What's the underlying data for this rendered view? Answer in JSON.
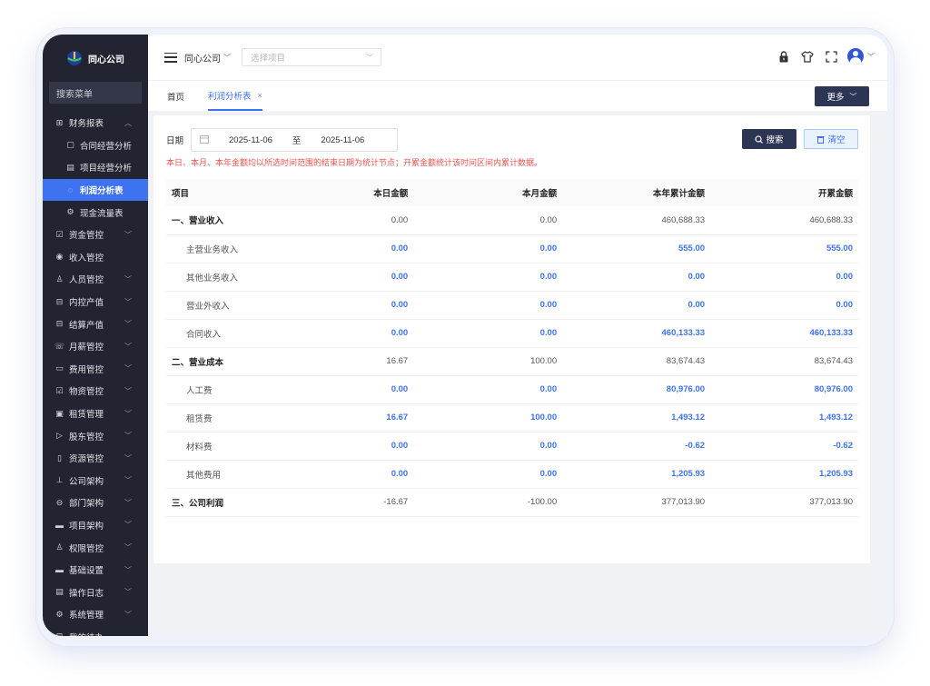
{
  "sidebar": {
    "logo_text": "同心公司",
    "search_label": "搜索菜单",
    "items": [
      {
        "label": "财务报表",
        "icon": "grid-icon",
        "chev": "^"
      },
      {
        "label": "合同经营分析",
        "icon": "document-icon",
        "chev": ""
      },
      {
        "label": "项目经营分析",
        "icon": "file-icon",
        "chev": ""
      },
      {
        "label": "利润分析表",
        "icon": "location-icon",
        "chev": ""
      },
      {
        "label": "现金流量表",
        "icon": "gear-icon",
        "chev": ""
      },
      {
        "label": "资金管控",
        "icon": "checkbox-icon",
        "chev": "v"
      },
      {
        "label": "收入管控",
        "icon": "circle-icon",
        "chev": ""
      },
      {
        "label": "人员管控",
        "icon": "user-icon",
        "chev": "v"
      },
      {
        "label": "内控产值",
        "icon": "table-icon",
        "chev": "v"
      },
      {
        "label": "结算产值",
        "icon": "table-icon",
        "chev": "v"
      },
      {
        "label": "月薪管控",
        "icon": "phone-icon",
        "chev": "v"
      },
      {
        "label": "费用管控",
        "icon": "wallet-icon",
        "chev": "v"
      },
      {
        "label": "物资管控",
        "icon": "checkbox-icon",
        "chev": "v"
      },
      {
        "label": "租赁管理",
        "icon": "lease-icon",
        "chev": "v"
      },
      {
        "label": "股东管控",
        "icon": "send-icon",
        "chev": "v"
      },
      {
        "label": "资源管控",
        "icon": "book-icon",
        "chev": "v"
      },
      {
        "label": "公司架构",
        "icon": "org-icon",
        "chev": "v"
      },
      {
        "label": "部门架构",
        "icon": "minus-circle-icon",
        "chev": "v"
      },
      {
        "label": "项目架构",
        "icon": "bar-icon",
        "chev": "v"
      },
      {
        "label": "权限管控",
        "icon": "user-icon",
        "chev": "v"
      },
      {
        "label": "基础设置",
        "icon": "bar-icon",
        "chev": "v"
      },
      {
        "label": "操作日志",
        "icon": "file-icon",
        "chev": "v"
      },
      {
        "label": "系统管理",
        "icon": "gear-icon",
        "chev": "v"
      },
      {
        "label": "我的待办",
        "icon": "table-icon",
        "chev": ""
      }
    ]
  },
  "topbar": {
    "company": "同心公司",
    "project_placeholder": "选择项目"
  },
  "tabs": {
    "home": "首页",
    "active": "利润分析表",
    "close": "×",
    "more_label": "更多"
  },
  "filter": {
    "date_label": "日期",
    "start": "2025-11-06",
    "separator": "至",
    "end": "2025-11-06",
    "search_label": "搜索",
    "clear_label": "清空",
    "notice": "本日、本月、本年金额均以所选时间范围的结束日期为统计节点；开累金额统计该时间区间内累计数据。"
  },
  "table": {
    "headers": [
      "项目",
      "本日金额",
      "本月金额",
      "本年累计金额",
      "开累金额"
    ],
    "rows": [
      {
        "type": "group",
        "cells": [
          "一、营业收入",
          "0.00",
          "0.00",
          "460,688.33",
          "460,688.33"
        ]
      },
      {
        "type": "child",
        "cells": [
          "主营业务收入",
          "0.00",
          "0.00",
          "555.00",
          "555.00"
        ]
      },
      {
        "type": "child",
        "cells": [
          "其他业务收入",
          "0.00",
          "0.00",
          "0.00",
          "0.00"
        ]
      },
      {
        "type": "child",
        "cells": [
          "营业外收入",
          "0.00",
          "0.00",
          "0.00",
          "0.00"
        ]
      },
      {
        "type": "child",
        "cells": [
          "合同收入",
          "0.00",
          "0.00",
          "460,133.33",
          "460,133.33"
        ]
      },
      {
        "type": "group",
        "cells": [
          "二、营业成本",
          "16.67",
          "100.00",
          "83,674.43",
          "83,674.43"
        ]
      },
      {
        "type": "child",
        "cells": [
          "人工费",
          "0.00",
          "0.00",
          "80,976.00",
          "80,976.00"
        ]
      },
      {
        "type": "child",
        "cells": [
          "租赁费",
          "16.67",
          "100.00",
          "1,493.12",
          "1,493.12"
        ]
      },
      {
        "type": "child",
        "cells": [
          "材料费",
          "0.00",
          "0.00",
          "-0.62",
          "-0.62"
        ]
      },
      {
        "type": "child",
        "cells": [
          "其他费用",
          "0.00",
          "0.00",
          "1,205.93",
          "1,205.93"
        ]
      },
      {
        "type": "group",
        "cells": [
          "三、公司利润",
          "-16.67",
          "-100.00",
          "377,013.90",
          "377,013.90"
        ]
      }
    ]
  },
  "colors": {
    "sidebar_bg": "#222432",
    "accent": "#3d72f0",
    "notice": "#f0524f",
    "button_dark": "#2c3654"
  }
}
